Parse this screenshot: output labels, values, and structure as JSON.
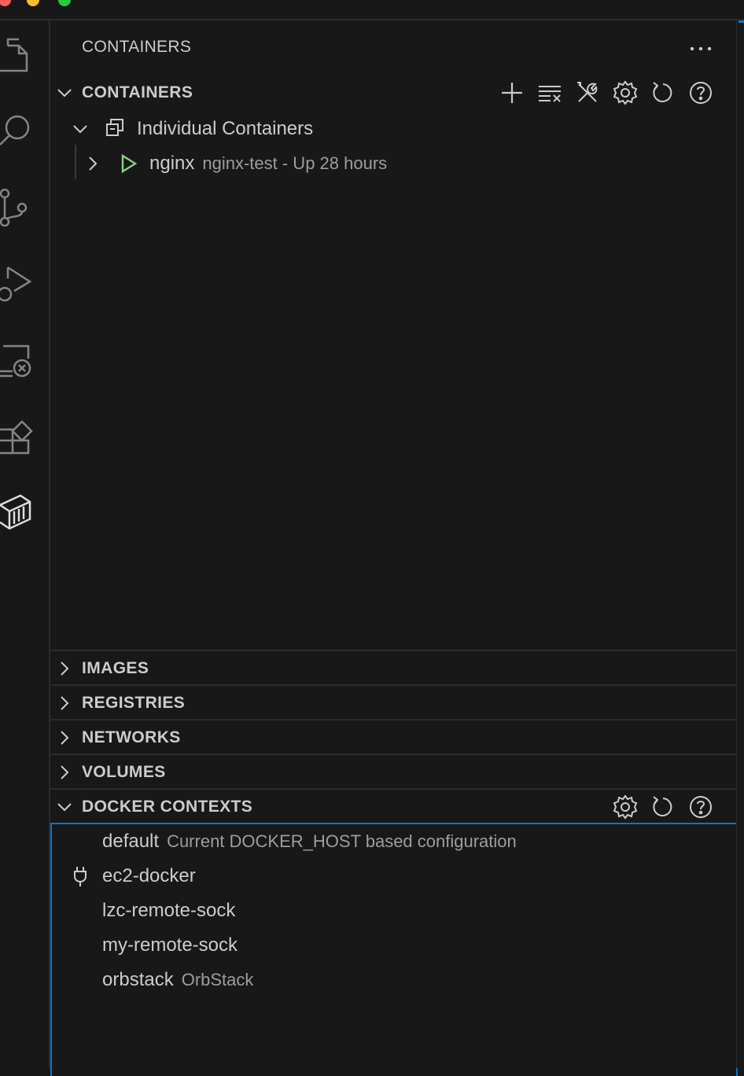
{
  "panel": {
    "title": "CONTAINERS",
    "more_icon": "ellipsis-icon"
  },
  "activity_bar": {
    "items": [
      {
        "icon": "explorer-icon"
      },
      {
        "icon": "search-icon"
      },
      {
        "icon": "source-control-icon"
      },
      {
        "icon": "run-debug-icon"
      },
      {
        "icon": "remote-explorer-icon"
      },
      {
        "icon": "extensions-icon"
      },
      {
        "icon": "docker-icon"
      }
    ]
  },
  "containers_section": {
    "label": "CONTAINERS",
    "toolbar": [
      "add-icon",
      "clear-all-icon",
      "tools-icon",
      "gear-icon",
      "refresh-icon",
      "help-icon"
    ],
    "group": {
      "label": "Individual Containers"
    },
    "items": [
      {
        "name": "nginx",
        "description": "nginx-test - Up 28 hours",
        "status_color": "#89d185"
      }
    ]
  },
  "collapsed_sections": [
    {
      "label": "IMAGES"
    },
    {
      "label": "REGISTRIES"
    },
    {
      "label": "NETWORKS"
    },
    {
      "label": "VOLUMES"
    }
  ],
  "contexts_section": {
    "label": "DOCKER CONTEXTS",
    "toolbar": [
      "gear-icon",
      "refresh-icon",
      "help-icon"
    ],
    "items": [
      {
        "name": "default",
        "description": "Current DOCKER_HOST based configuration"
      },
      {
        "name": "ec2-docker",
        "description": "",
        "icon": "plug-icon"
      },
      {
        "name": "lzc-remote-sock",
        "description": ""
      },
      {
        "name": "my-remote-sock",
        "description": ""
      },
      {
        "name": "orbstack",
        "description": "OrbStack"
      }
    ]
  },
  "colors": {
    "background": "#181818",
    "accent": "#0078d4",
    "text": "#cccccc",
    "description": "#9d9d9d",
    "running": "#89d185"
  }
}
